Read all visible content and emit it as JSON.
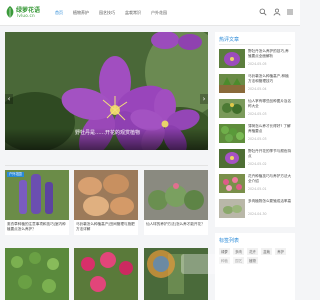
{
  "header": {
    "logo_text": "绿萝花语",
    "logo_sub": "lvluo.cn",
    "nav": [
      "首页",
      "植物养护",
      "园艺技巧",
      "盆栽常识",
      "户外花园"
    ],
    "icons": [
      "search-icon",
      "user-icon",
      "menu-icon"
    ]
  },
  "hero": {
    "title": "野牡丹是……开花的观赏植物"
  },
  "sidebar": {
    "title": "热评文章",
    "items": [
      {
        "text": "野牡丹怎么养护的技巧,养殖要点全面解析",
        "date": "2024-05-05"
      },
      {
        "text": "马铃薯怎么种植高产,种植方法和管理技巧",
        "date": "2024-05-04"
      },
      {
        "text": "仙人掌有哪些品种图片及名称大全",
        "date": "2024-05-03"
      },
      {
        "text": "薄荷怎么养才长得好? 了解养殖要点",
        "date": "2024-05-03"
      },
      {
        "text": "野牡丹开花的季节与颜色特点",
        "date": "2024-05-02"
      },
      {
        "text": "花卉种植技巧与养护方法大全介绍",
        "date": "2024-05-01"
      },
      {
        "text": "多肉植物怎么繁殖成活率高",
        "date": "2024-04-30"
      }
    ]
  },
  "section": {
    "tag": "户外花园",
    "cards": [
      {
        "text": "薰衣草种植的注意事项和技巧|室内种植要点怎么养护？"
      },
      {
        "text": "马铃薯怎么种植高产|田间管理与施肥方法详解"
      },
      {
        "text": "仙人球的养护方法|怎么养才能开花？"
      }
    ]
  },
  "side2": {
    "title": "标签列表",
    "tags": [
      "绿萝",
      "多肉",
      "花卉",
      "盆栽",
      "养护",
      "种植",
      "园艺",
      "植物"
    ]
  }
}
